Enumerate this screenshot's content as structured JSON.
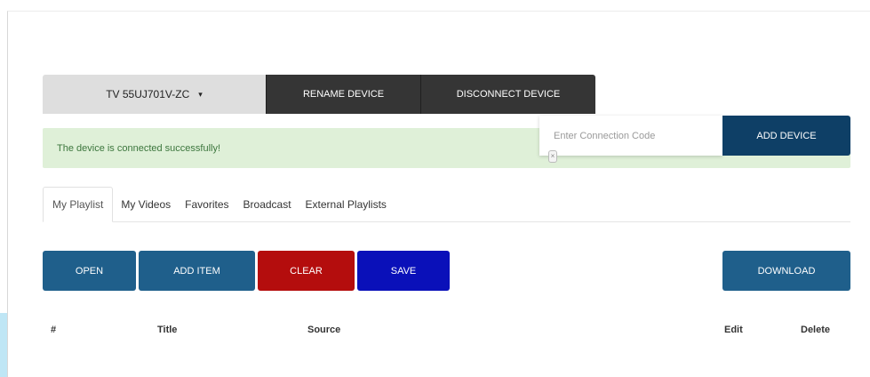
{
  "device_bar": {
    "selected_device": "TV 55UJ701V-ZC",
    "caret": "▾",
    "rename_label": "RENAME DEVICE",
    "disconnect_label": "DISCONNECT DEVICE"
  },
  "alert": {
    "message": "The device is connected successfully!"
  },
  "connection": {
    "placeholder": "Enter Connection Code",
    "value": "",
    "add_label": "ADD DEVICE"
  },
  "tabs": [
    {
      "label": "My Playlist",
      "active": true
    },
    {
      "label": "My Videos",
      "active": false
    },
    {
      "label": "Favorites",
      "active": false
    },
    {
      "label": "Broadcast",
      "active": false
    },
    {
      "label": "External Playlists",
      "active": false
    }
  ],
  "actions": {
    "open_label": "OPEN",
    "add_item_label": "ADD ITEM",
    "clear_label": "CLEAR",
    "save_label": "SAVE",
    "download_label": "DOWNLOAD"
  },
  "table": {
    "columns": [
      "#",
      "Title",
      "Source",
      "Edit",
      "Delete"
    ],
    "rows": []
  },
  "colors": {
    "primary_button": "#1f5f8b",
    "add_device_button": "#0e3f66",
    "clear_button": "#b40d0d",
    "save_button": "#0a10b9",
    "dark_button": "#353535",
    "success_bg": "#dff0d8",
    "success_text": "#3c763d"
  }
}
